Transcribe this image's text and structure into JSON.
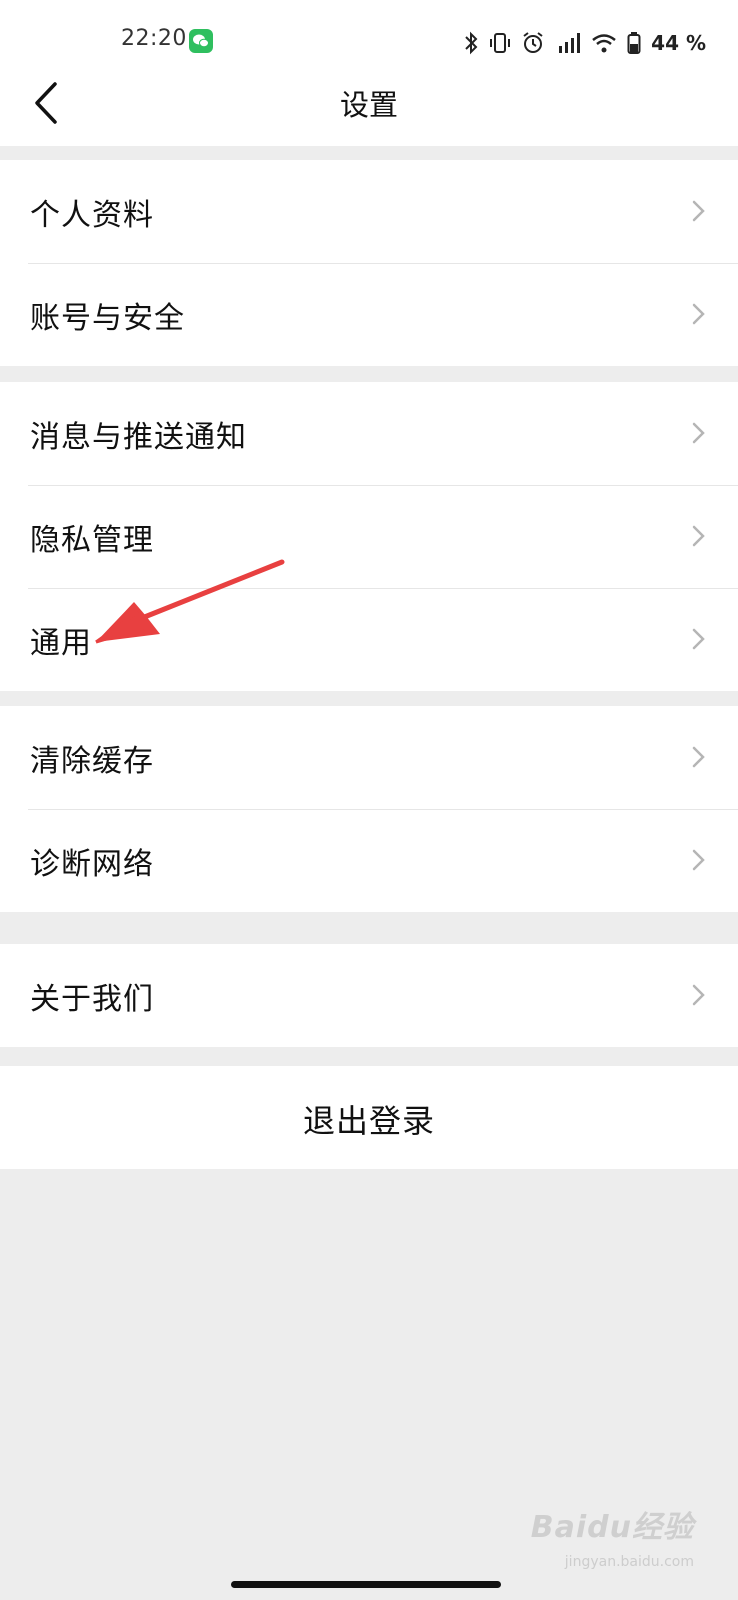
{
  "status_bar": {
    "time": "22:20",
    "battery_percent": "44 %",
    "icons": [
      "wechat-icon",
      "bluetooth-icon",
      "vibrate-icon",
      "alarm-icon",
      "hd-signal-icon",
      "wifi-icon",
      "battery-icon"
    ]
  },
  "nav": {
    "title": "设置",
    "back_icon": "back-arrow-icon"
  },
  "groups": [
    {
      "items": [
        {
          "label": "个人资料"
        },
        {
          "label": "账号与安全"
        }
      ]
    },
    {
      "items": [
        {
          "label": "消息与推送通知"
        },
        {
          "label": "隐私管理"
        },
        {
          "label": "通用"
        }
      ]
    },
    {
      "items": [
        {
          "label": "清除缓存"
        },
        {
          "label": "诊断网络"
        }
      ]
    },
    {
      "items": [
        {
          "label": "关于我们"
        }
      ]
    }
  ],
  "logout": {
    "label": "退出登录"
  },
  "annotation": {
    "type": "red-arrow",
    "points_to": "通用"
  },
  "watermark": {
    "text": "Baidu经验",
    "sub": "jingyan.baidu.com"
  },
  "colors": {
    "background": "#ededed",
    "surface": "#ffffff",
    "divider": "#e6e6e6",
    "chevron": "#b5b5b5",
    "wechat": "#2fbf5f",
    "annotation": "#e84040"
  }
}
